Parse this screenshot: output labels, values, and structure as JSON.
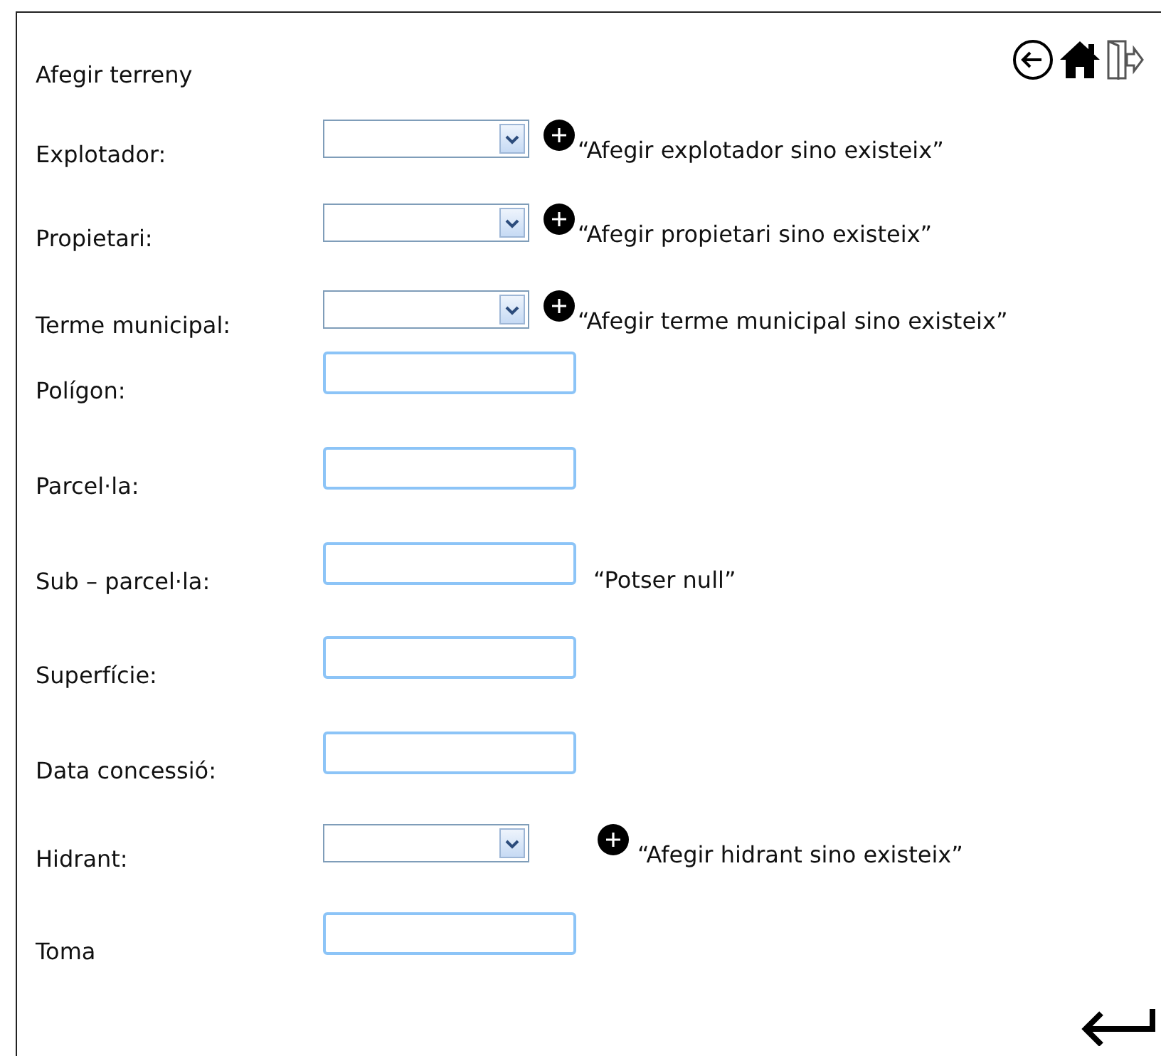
{
  "title": "Afegir terreny",
  "fields": [
    {
      "label": "Explotador:",
      "kind": "select",
      "add_hint": "“Afegir explotador sino existeix”"
    },
    {
      "label": "Propietari:",
      "kind": "select",
      "add_hint": "“Afegir propietari sino existeix”"
    },
    {
      "label": "Terme municipal:",
      "kind": "select",
      "add_hint": "“Afegir terme municipal sino existeix”"
    },
    {
      "label": "Polígon:",
      "kind": "text"
    },
    {
      "label": "Parcel·la:",
      "kind": "text"
    },
    {
      "label": "Sub – parcel·la:",
      "kind": "text",
      "note": "“Potser null”"
    },
    {
      "label": "Superfície:",
      "kind": "text"
    },
    {
      "label": "Data concessió:",
      "kind": "text"
    },
    {
      "label": "Hidrant:",
      "kind": "select",
      "add_hint": "“Afegir hidrant sino existeix”",
      "gap": true
    },
    {
      "label": "Toma",
      "kind": "text"
    }
  ]
}
